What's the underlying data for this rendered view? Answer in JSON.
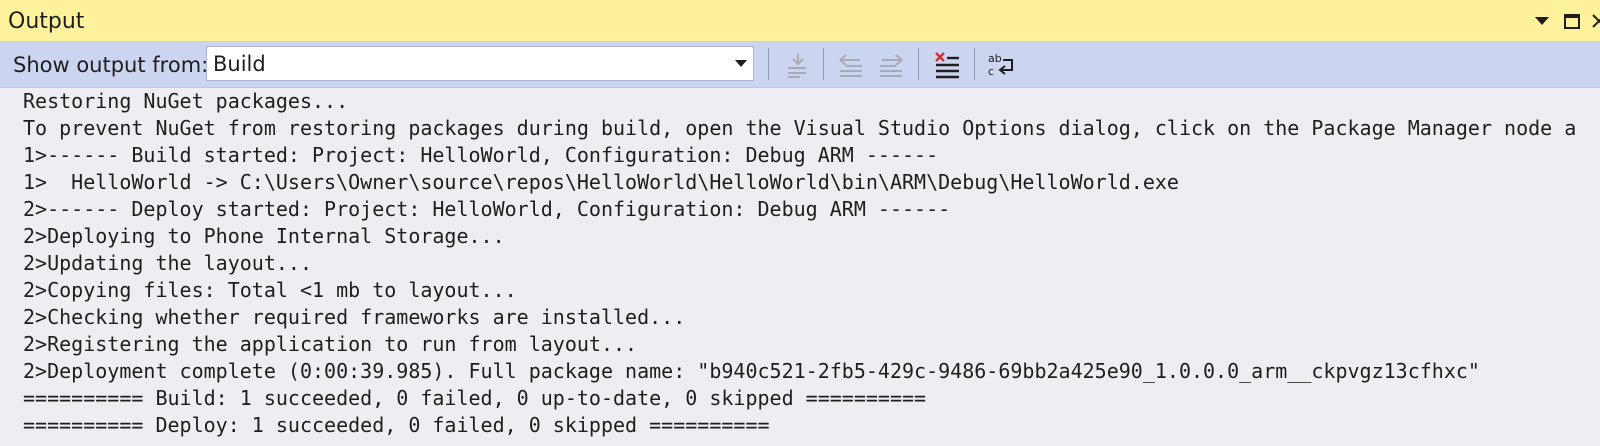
{
  "window": {
    "title": "Output",
    "dropdown_icon": "dropdown-arrow-icon",
    "maximize_icon": "maximize-icon",
    "close_icon": "close-icon"
  },
  "toolbar": {
    "show_output_label": "Show output from:",
    "source_selected": "Build",
    "tools": [
      "go-to-line-icon",
      "previous-message-icon",
      "next-message-icon",
      "clear-all-icon",
      "toggle-word-wrap-icon"
    ]
  },
  "output": {
    "lines": [
      "Restoring NuGet packages...",
      "To prevent NuGet from restoring packages during build, open the Visual Studio Options dialog, click on the Package Manager node a",
      "1>------ Build started: Project: HelloWorld, Configuration: Debug ARM ------",
      "1>  HelloWorld -> C:\\Users\\Owner\\source\\repos\\HelloWorld\\HelloWorld\\bin\\ARM\\Debug\\HelloWorld.exe",
      "2>------ Deploy started: Project: HelloWorld, Configuration: Debug ARM ------",
      "2>Deploying to Phone Internal Storage...",
      "2>Updating the layout...",
      "2>Copying files: Total <1 mb to layout...",
      "2>Checking whether required frameworks are installed...",
      "2>Registering the application to run from layout...",
      "2>Deployment complete (0:00:39.985). Full package name: \"b940c521-2fb5-429c-9486-69bb2a425e90_1.0.0.0_arm__ckpvgz13cfhxc\"",
      "========== Build: 1 succeeded, 0 failed, 0 up-to-date, 0 skipped ==========",
      "========== Deploy: 1 succeeded, 0 failed, 0 skipped =========="
    ]
  }
}
